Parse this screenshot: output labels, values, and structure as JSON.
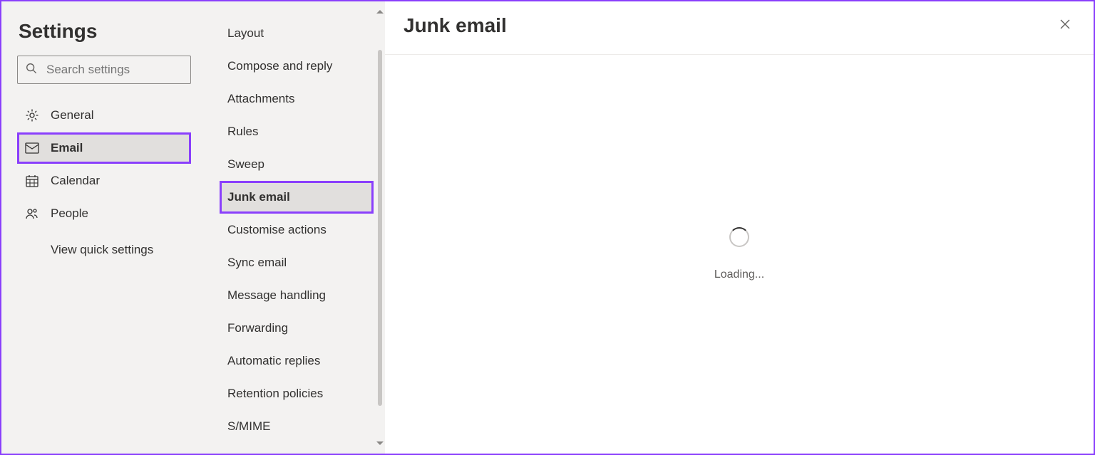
{
  "title": "Settings",
  "search": {
    "placeholder": "Search settings"
  },
  "categories": [
    {
      "key": "general",
      "label": "General",
      "icon": "gear-icon",
      "selected": false
    },
    {
      "key": "email",
      "label": "Email",
      "icon": "mail-icon",
      "selected": true,
      "highlight": true
    },
    {
      "key": "calendar",
      "label": "Calendar",
      "icon": "calendar-icon",
      "selected": false
    },
    {
      "key": "people",
      "label": "People",
      "icon": "people-icon",
      "selected": false
    }
  ],
  "quick_settings_label": "View quick settings",
  "subnav": [
    {
      "key": "layout",
      "label": "Layout"
    },
    {
      "key": "compose",
      "label": "Compose and reply"
    },
    {
      "key": "attachments",
      "label": "Attachments"
    },
    {
      "key": "rules",
      "label": "Rules"
    },
    {
      "key": "sweep",
      "label": "Sweep"
    },
    {
      "key": "junk",
      "label": "Junk email",
      "selected": true,
      "highlight": true
    },
    {
      "key": "customise",
      "label": "Customise actions"
    },
    {
      "key": "sync",
      "label": "Sync email"
    },
    {
      "key": "message-handling",
      "label": "Message handling"
    },
    {
      "key": "forwarding",
      "label": "Forwarding"
    },
    {
      "key": "auto-replies",
      "label": "Automatic replies"
    },
    {
      "key": "retention",
      "label": "Retention policies"
    },
    {
      "key": "smime",
      "label": "S/MIME"
    }
  ],
  "content": {
    "title": "Junk email",
    "loading_label": "Loading..."
  },
  "highlight_color": "#8a3ffc"
}
